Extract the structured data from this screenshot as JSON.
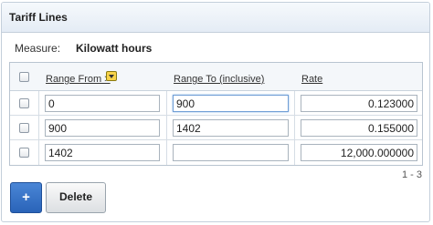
{
  "panel": {
    "title": "Tariff Lines"
  },
  "measure": {
    "label": "Measure:",
    "value": "Kilowatt hours"
  },
  "table": {
    "columns": [
      "Range From >",
      "Range To (inclusive)",
      "Rate"
    ],
    "rows": [
      {
        "range_from": "0",
        "range_to": "900",
        "rate": "0.123000"
      },
      {
        "range_from": "900",
        "range_to": "1402",
        "rate": "0.155000"
      },
      {
        "range_from": "1402",
        "range_to": "",
        "rate": "12,000.000000"
      }
    ]
  },
  "pagination": {
    "text": "1 - 3"
  },
  "buttons": {
    "add": "+",
    "delete": "Delete"
  },
  "colors": {
    "accent": "#2a63b8",
    "header_bg": "#e4ecf5",
    "border": "#c4cfdb"
  }
}
